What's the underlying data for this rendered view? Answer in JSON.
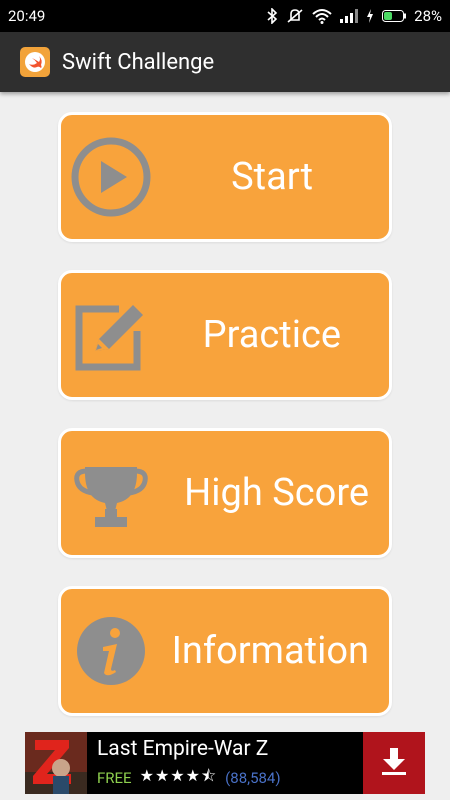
{
  "status_bar": {
    "time": "20:49",
    "battery": "28%"
  },
  "app_bar": {
    "title": "Swift Challenge"
  },
  "menu": {
    "items": [
      {
        "label": "Start",
        "icon": "play-circle-icon"
      },
      {
        "label": "Practice",
        "icon": "edit-pencil-icon"
      },
      {
        "label": "High Score",
        "icon": "trophy-icon"
      },
      {
        "label": "Information",
        "icon": "info-circle-icon"
      }
    ]
  },
  "ad": {
    "title": "Last Empire-War Z",
    "price": "FREE",
    "stars": "★★★★⯪",
    "rating_count": "(88,584)",
    "icon": "download-icon"
  },
  "colors": {
    "button_bg": "#f8a33c",
    "icon_gray": "#8e8e8e",
    "app_bar": "#2f2f2f",
    "download_bg": "#b0141c"
  }
}
